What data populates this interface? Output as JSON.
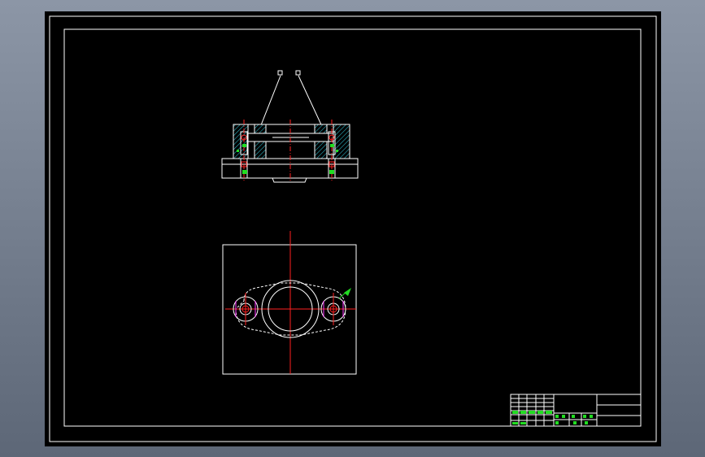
{
  "drawing": {
    "background": "#000000",
    "line_color": "#ffffff",
    "centerline_color": "#ff2020",
    "dimension_color": "#22dd22",
    "marker_color": "#ff33ff",
    "section_labels": [
      "",
      ""
    ]
  }
}
